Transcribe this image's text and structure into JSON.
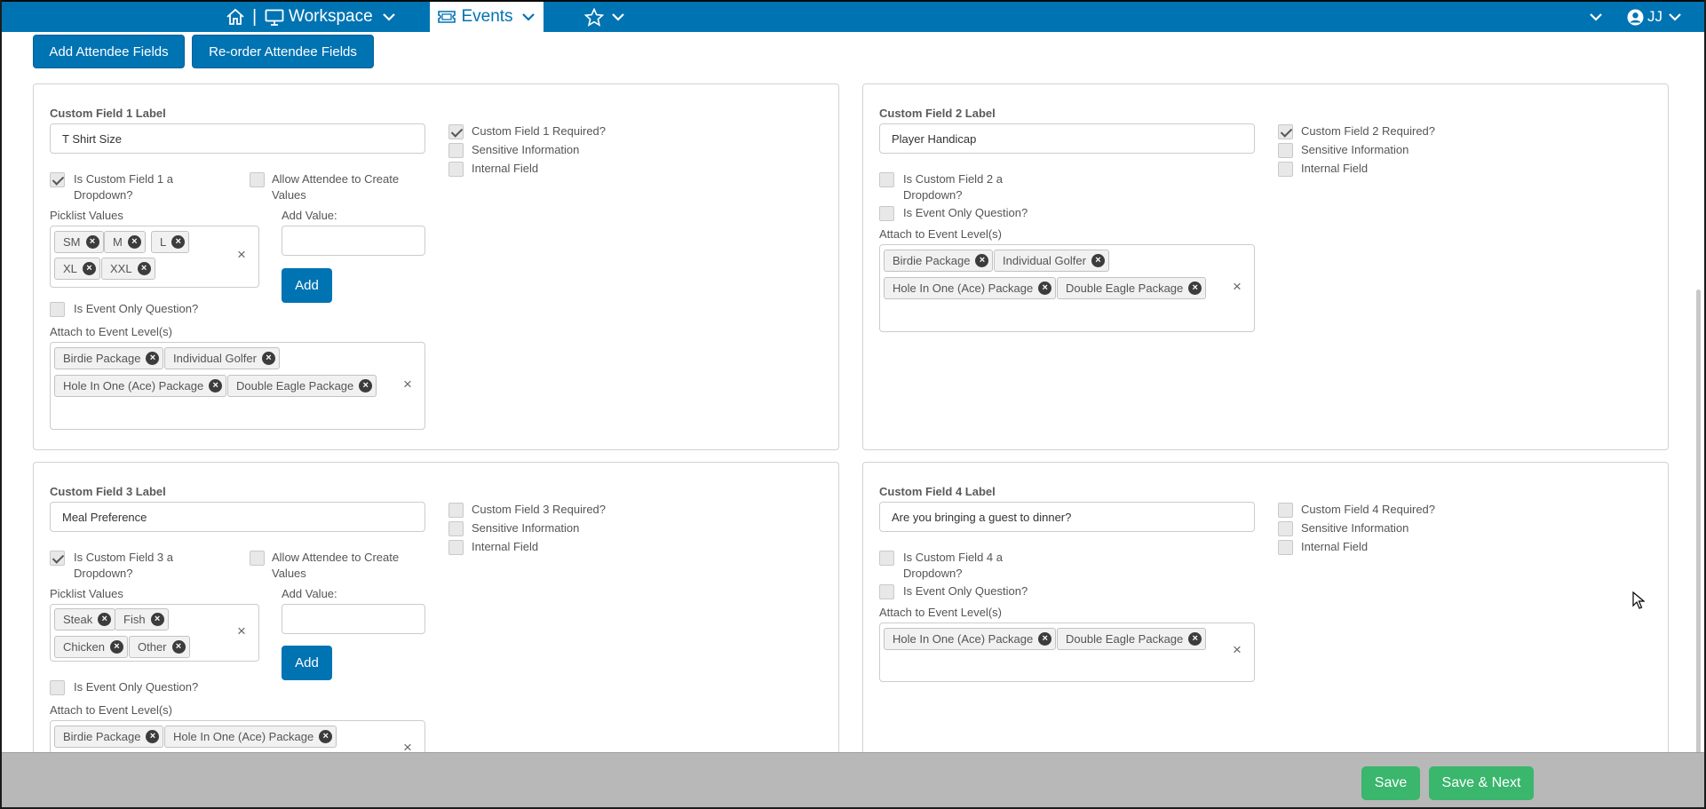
{
  "nav": {
    "workspace_label": "Workspace",
    "events_label": "Events",
    "separator": "|",
    "user_initials": "JJ",
    "icons": [
      "home-icon",
      "monitor-icon",
      "chevron-down-icon",
      "ticket-icon",
      "star-icon",
      "user-circle-icon"
    ]
  },
  "toolbar": {
    "add_fields_label": "Add Attendee Fields",
    "reorder_fields_label": "Re-order Attendee Fields"
  },
  "common": {
    "picklist_label": "Picklist Values",
    "add_value_label": "Add Value:",
    "add_button": "Add",
    "allow_create_label": "Allow Attendee to Create Values",
    "event_only_label": "Is Event Only Question?",
    "attach_label": "Attach to Event Level(s)",
    "sensitive_label": "Sensitive Information",
    "internal_label": "Internal Field",
    "remove_glyph": "×",
    "clear_glyph": "×"
  },
  "fields": [
    {
      "label": "Custom Field 1 Label",
      "value": "T Shirt Size",
      "required_label": "Custom Field 1 Required?",
      "required": true,
      "dropdown_label": "Is Custom Field 1 a Dropdown?",
      "dropdown": true,
      "picklist": [
        "SM",
        "M",
        "L",
        "XL",
        "XXL"
      ],
      "levels": [
        "Birdie Package",
        "Individual Golfer",
        "Hole In One (Ace) Package",
        "Double Eagle Package"
      ]
    },
    {
      "label": "Custom Field 2 Label",
      "value": "Player Handicap",
      "required_label": "Custom Field 2 Required?",
      "required": true,
      "dropdown_label": "Is Custom Field 2 a Dropdown?",
      "dropdown": false,
      "levels": [
        "Birdie Package",
        "Individual Golfer",
        "Hole In One (Ace) Package",
        "Double Eagle Package"
      ]
    },
    {
      "label": "Custom Field 3 Label",
      "value": "Meal Preference",
      "required_label": "Custom Field 3 Required?",
      "required": false,
      "dropdown_label": "Is Custom Field 3 a Dropdown?",
      "dropdown": true,
      "picklist": [
        "Steak",
        "Fish",
        "Chicken",
        "Other"
      ],
      "levels": [
        "Birdie Package",
        "Hole In One (Ace) Package"
      ]
    },
    {
      "label": "Custom Field 4 Label",
      "value": "Are you bringing a guest to dinner?",
      "required_label": "Custom Field 4 Required?",
      "required": false,
      "dropdown_label": "Is Custom Field 4 a Dropdown?",
      "dropdown": false,
      "levels": [
        "Hole In One (Ace) Package",
        "Double Eagle Package"
      ]
    }
  ],
  "footer": {
    "save_label": "Save",
    "save_next_label": "Save & Next"
  },
  "colors": {
    "primary": "#0073b3",
    "success": "#3ab66d",
    "footer_bg": "#b8b8b8"
  }
}
